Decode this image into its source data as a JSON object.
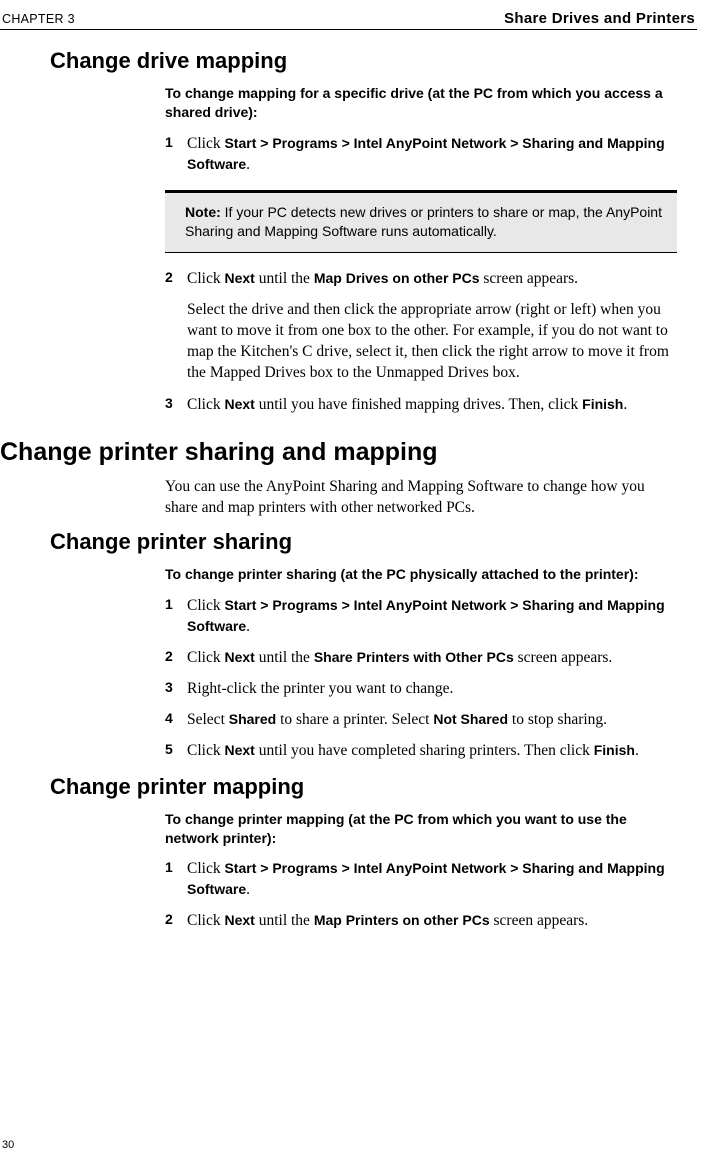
{
  "header": {
    "chapter": "CHAPTER 3",
    "title": "Share Drives and Printers"
  },
  "section1": {
    "heading": "Change drive mapping",
    "intro": "To change mapping for a specific drive (at the PC from which you access a shared drive):",
    "steps": {
      "s1_num": "1",
      "s1_pre": "Click ",
      "s1_bold": "Start > Programs > Intel AnyPoint Network > Sharing and Mapping Software",
      "s1_post": ".",
      "note_label": "Note:  ",
      "note_text": "If your PC detects new drives or printers to share or map, the AnyPoint Sharing and Mapping Software runs automatically.",
      "s2_num": "2",
      "s2_pre": "Click ",
      "s2_b1": "Next",
      "s2_mid": " until the ",
      "s2_b2": "Map Drives on other PCs",
      "s2_post": " screen appears.",
      "s2_sub_a": "Select the drive and then click the appropriate arrow (right or left) when you want to move it from one box to the other. For example, if you do not want to map the Kitchen's C drive, select it, then click the right arrow to move it from the ",
      "s2_sub_b1": "Mapped Drives",
      "s2_sub_mid": " box to the ",
      "s2_sub_b2": "Unmapped Drives",
      "s2_sub_post": " box.",
      "s3_num": "3",
      "s3_pre": "Click ",
      "s3_b1": "Next",
      "s3_mid": " until you have finished mapping drives. Then, click ",
      "s3_b2": "Finish",
      "s3_post": "."
    }
  },
  "section2": {
    "heading": "Change printer sharing and mapping",
    "para": "You can use the AnyPoint Sharing and Mapping Software to change how you share and map printers with other networked PCs."
  },
  "section3": {
    "heading": "Change printer sharing",
    "intro": "To change printer sharing (at the PC physically attached to the printer):",
    "steps": {
      "s1_num": "1",
      "s1_pre": "Click ",
      "s1_bold": "Start > Programs > Intel AnyPoint Network > Sharing and Mapping Software",
      "s1_post": ".",
      "s2_num": "2",
      "s2_pre": "Click ",
      "s2_b1": "Next",
      "s2_mid": " until the ",
      "s2_b2": "Share Printers with Other PCs",
      "s2_post": " screen appears.",
      "s3_num": "3",
      "s3_text": "Right-click the printer you want to change.",
      "s4_num": "4",
      "s4_pre": "Select ",
      "s4_b1": "Shared",
      "s4_mid": " to share a printer. Select ",
      "s4_b2": "Not Shared",
      "s4_post": " to stop sharing.",
      "s5_num": "5",
      "s5_pre": "Click ",
      "s5_b1": "Next",
      "s5_mid": " until you have completed sharing printers. Then click ",
      "s5_b2": "Finish",
      "s5_post": "."
    }
  },
  "section4": {
    "heading": "Change printer mapping",
    "intro": "To change printer mapping (at the PC from which you want to use the network printer):",
    "steps": {
      "s1_num": "1",
      "s1_pre": "Click ",
      "s1_bold": "Start > Programs > Intel AnyPoint Network > Sharing and Mapping Software",
      "s1_post": ".",
      "s2_num": "2",
      "s2_pre": "Click ",
      "s2_b1": "Next",
      "s2_mid": " until the ",
      "s2_b2": "Map Printers on other PCs",
      "s2_post": " screen appears."
    }
  },
  "page_number": "30"
}
